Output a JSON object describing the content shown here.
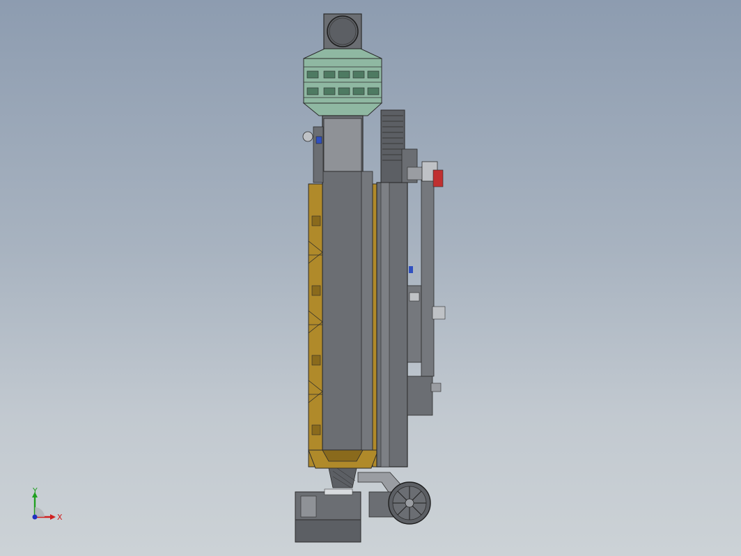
{
  "viewport": {
    "background_top": "#8d9cb0",
    "background_bottom": "#ccd2d6"
  },
  "model": {
    "colors": {
      "steel": "#6b6e73",
      "steel_dark": "#54575b",
      "steel_light": "#9a9da2",
      "filter_green": "#8fb8a2",
      "filter_green_dark": "#4e7a62",
      "insulation": "#b08a2a",
      "insulation_dark": "#8a6a1c",
      "accent_red": "#c03030",
      "accent_blue": "#3050c0"
    },
    "icons": [
      "fan-icon",
      "cyclone-icon",
      "filter-icon",
      "duct-icon",
      "valve-icon",
      "ladder-icon"
    ]
  },
  "triad": {
    "x_label": "X",
    "y_label": "Y",
    "x_color": "#d02020",
    "y_color": "#20a020",
    "z_color": "#2030c0"
  }
}
